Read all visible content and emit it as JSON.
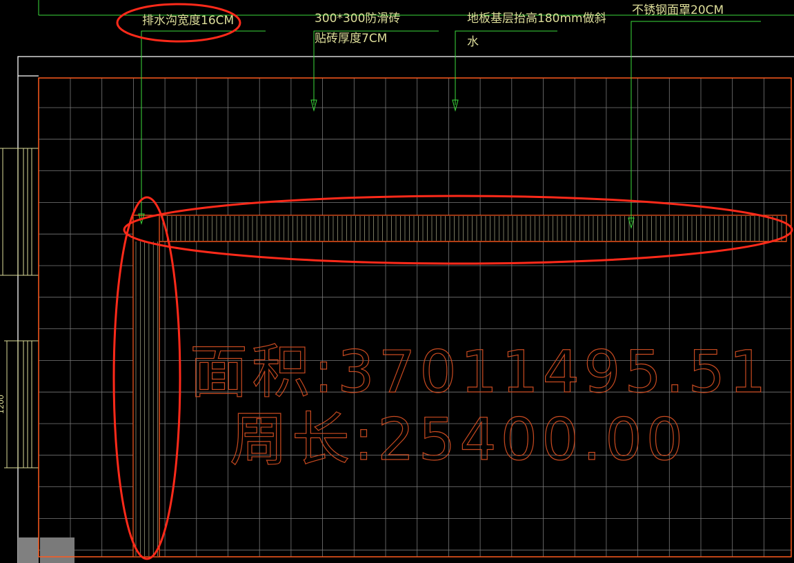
{
  "annotations": {
    "drain_width": "排水沟宽度16CM",
    "tile_line1": "300*300防滑砖",
    "tile_line2": "贴砖厚度7CM",
    "floor_line1": "地板基层抬高180mm做斜",
    "floor_line2": "水",
    "cover": "不锈钢面罩20CM"
  },
  "measurements": {
    "area": "面积:37011495.51",
    "perimeter": "周长:25400.00"
  },
  "dimension": {
    "window_width": "1200"
  },
  "colors": {
    "background": "#000000",
    "wall": "#ffffff",
    "room_outline": "#ff5a1e",
    "grid": "#7a7a7a",
    "leader": "#3cdc3c",
    "label": "#dede9a",
    "highlight": "#ff2a1a",
    "hatch": "#c8c8a0"
  }
}
